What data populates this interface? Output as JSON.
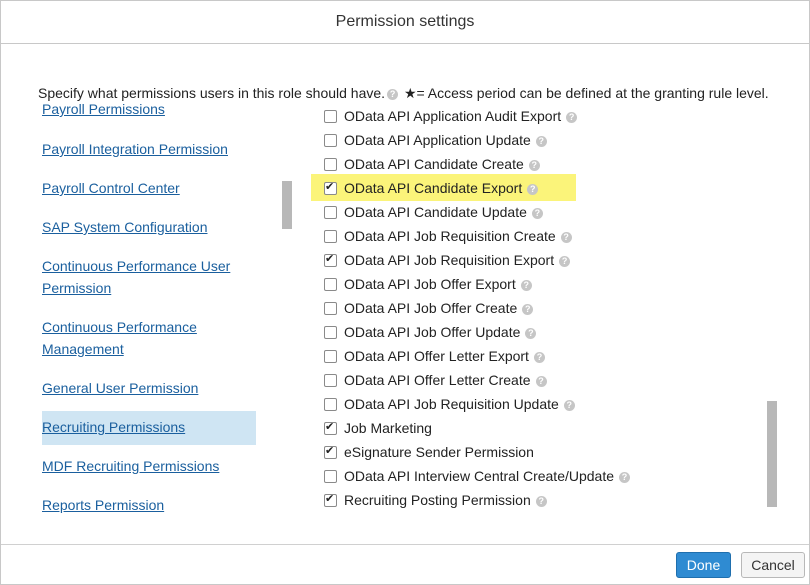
{
  "dialog": {
    "title": "Permission settings",
    "description": "Specify what permissions users in this role should have.",
    "star_note": "★= Access period can be defined at the granting rule level."
  },
  "nav": {
    "items": [
      {
        "label": "Payroll Permissions",
        "selected": false
      },
      {
        "label": "Payroll Integration Permission",
        "selected": false
      },
      {
        "label": "Payroll Control Center",
        "selected": false
      },
      {
        "label": "SAP System Configuration",
        "selected": false
      },
      {
        "label": "Continuous Performance User",
        "label2": "Permission",
        "selected": false
      },
      {
        "label": "Continuous Performance",
        "label2": "Management",
        "selected": false
      },
      {
        "label": "General User Permission",
        "selected": false
      },
      {
        "label": "Recruiting Permissions",
        "selected": true
      },
      {
        "label": "MDF Recruiting Permissions",
        "selected": false
      },
      {
        "label": "Reports Permission",
        "selected": false
      }
    ]
  },
  "permissions": [
    {
      "label": "OData API Application Audit Export",
      "checked": false,
      "help": true
    },
    {
      "label": "OData API Application Update",
      "checked": false,
      "help": true
    },
    {
      "label": "OData API Candidate Create",
      "checked": false,
      "help": true
    },
    {
      "label": "OData API Candidate Export",
      "checked": true,
      "help": true,
      "highlighted": true
    },
    {
      "label": "OData API Candidate Update",
      "checked": false,
      "help": true
    },
    {
      "label": "OData API Job Requisition Create",
      "checked": false,
      "help": true
    },
    {
      "label": "OData API Job Requisition Export",
      "checked": true,
      "help": true
    },
    {
      "label": "OData API Job Offer Export",
      "checked": false,
      "help": true
    },
    {
      "label": "OData API Job Offer Create",
      "checked": false,
      "help": true
    },
    {
      "label": "OData API Job Offer Update",
      "checked": false,
      "help": true
    },
    {
      "label": "OData API Offer Letter Export",
      "checked": false,
      "help": true
    },
    {
      "label": "OData API Offer Letter Create",
      "checked": false,
      "help": true
    },
    {
      "label": "OData API Job Requisition Update",
      "checked": false,
      "help": true
    },
    {
      "label": "Job Marketing",
      "checked": true,
      "help": false
    },
    {
      "label": "eSignature Sender Permission",
      "checked": true,
      "help": false
    },
    {
      "label": "OData API Interview Central Create/Update",
      "checked": false,
      "help": true
    },
    {
      "label": "Recruiting Posting Permission",
      "checked": true,
      "help": true
    }
  ],
  "buttons": {
    "done": "Done",
    "cancel": "Cancel"
  },
  "colors": {
    "link": "#1a5f9e",
    "selected_nav_bg": "#cfe5f3",
    "highlight": "#fbf47a",
    "primary_button": "#2f8bd2"
  },
  "icons": {
    "help": "?"
  }
}
